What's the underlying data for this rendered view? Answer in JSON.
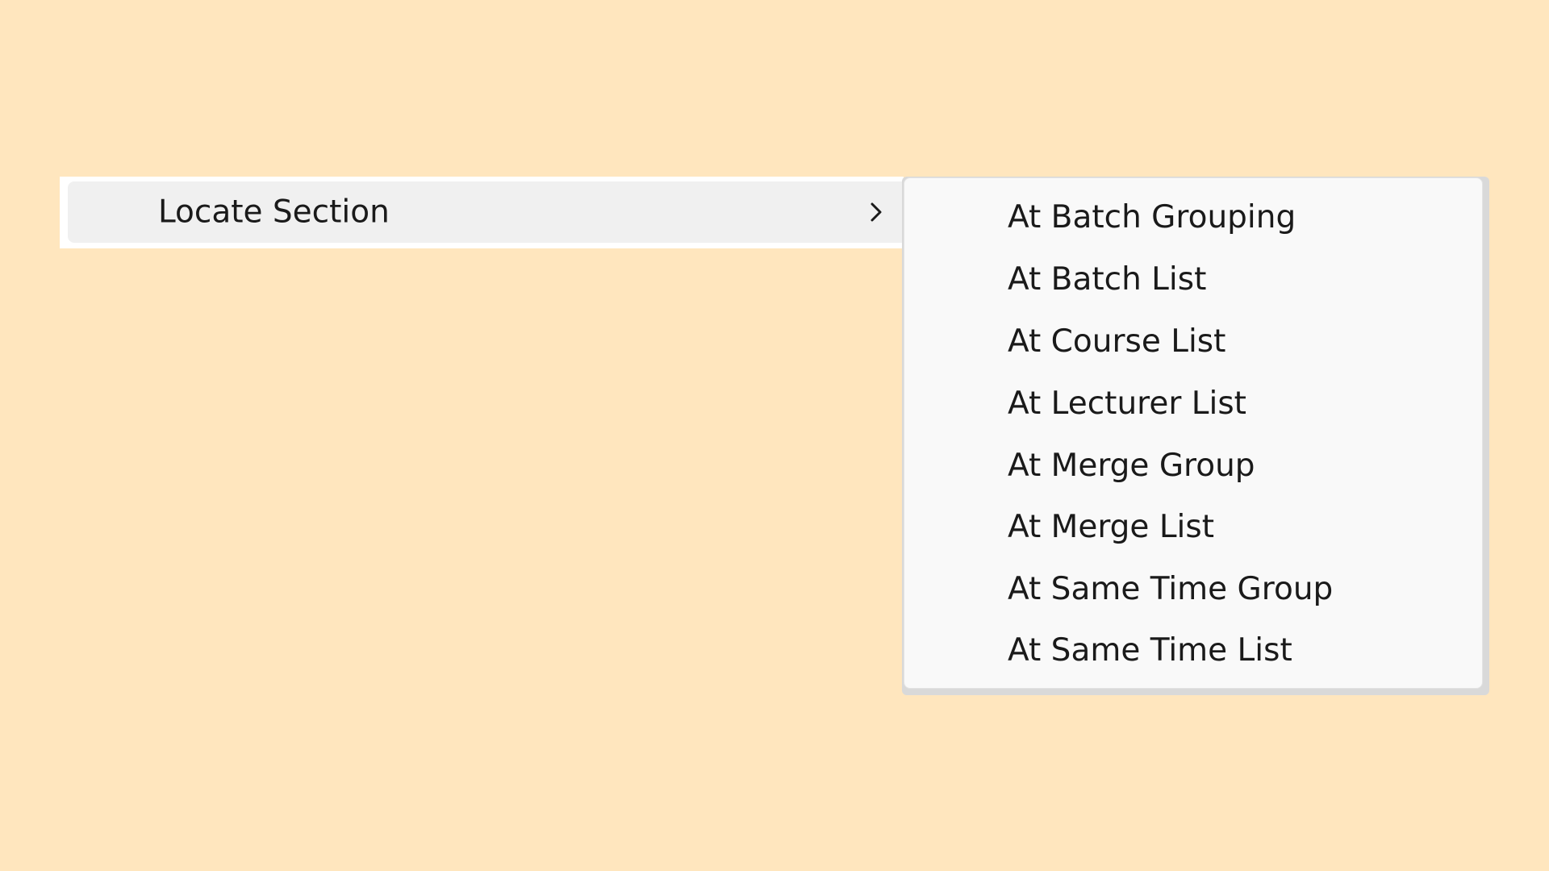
{
  "parent_menu": {
    "label": "Locate Section",
    "chevron_icon": "chevron-right-icon"
  },
  "submenu": {
    "items": [
      {
        "label": "At Batch Grouping"
      },
      {
        "label": "At Batch List"
      },
      {
        "label": "At Course List"
      },
      {
        "label": "At Lecturer List"
      },
      {
        "label": "At Merge Group"
      },
      {
        "label": "At Merge List"
      },
      {
        "label": "At Same Time Group"
      },
      {
        "label": "At Same Time List"
      }
    ]
  },
  "colors": {
    "background": "#FFE6BE",
    "menu_background": "#F9F9F9",
    "highlight": "#F0F0F0",
    "text": "#1A1A1A"
  }
}
